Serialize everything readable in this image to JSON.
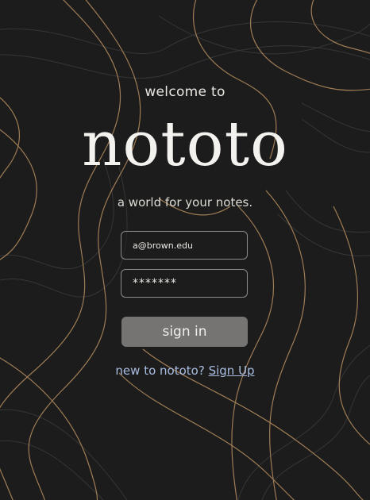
{
  "welcome_text": "welcome to",
  "app_name": "nototo",
  "tagline": "a world for your notes.",
  "form": {
    "email_value": "a@brown.edu",
    "password_value": "*******",
    "signin_label": "sign in"
  },
  "signup": {
    "prompt": "new to nototo?",
    "link_label": "Sign Up"
  },
  "colors": {
    "background": "#1c1c1c",
    "contour_gold": "#b58d5f",
    "contour_gray": "#3b3b3b",
    "button": "#767472",
    "link": "#a9bde0"
  }
}
